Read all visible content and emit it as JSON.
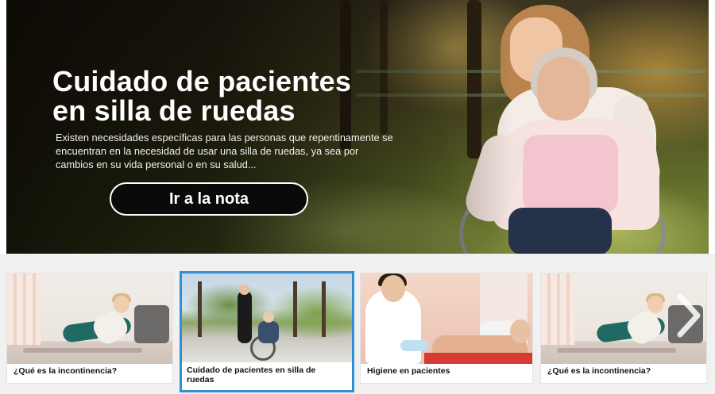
{
  "hero": {
    "title_line1": "Cuidado de pacientes",
    "title_line2": "en silla de ruedas",
    "description": "Existen necesidades específicas para las personas que repentinamente se encuentran en la necesidad de usar una silla de ruedas, ya sea por cambios en su vida personal o en su salud...",
    "button_label": "Ir a la nota"
  },
  "carousel": {
    "cards": [
      {
        "caption": "¿Qué es la incontinencia?",
        "image": "yoga-woman-stretching",
        "active": false
      },
      {
        "caption": "Cuidado de pacientes en silla de ruedas",
        "image": "park-wheelchair",
        "active": true
      },
      {
        "caption": "Higiene en pacientes",
        "image": "nurse-with-patient",
        "active": false
      },
      {
        "caption": "¿Qué es la incontinencia?",
        "image": "yoga-woman-stretching",
        "active": false
      }
    ],
    "next_icon": "chevron-right-icon"
  },
  "colors": {
    "active_border": "#2f8fd1",
    "button_bg": "#0a0a0a",
    "strip_bg": "#f1f1f1"
  }
}
